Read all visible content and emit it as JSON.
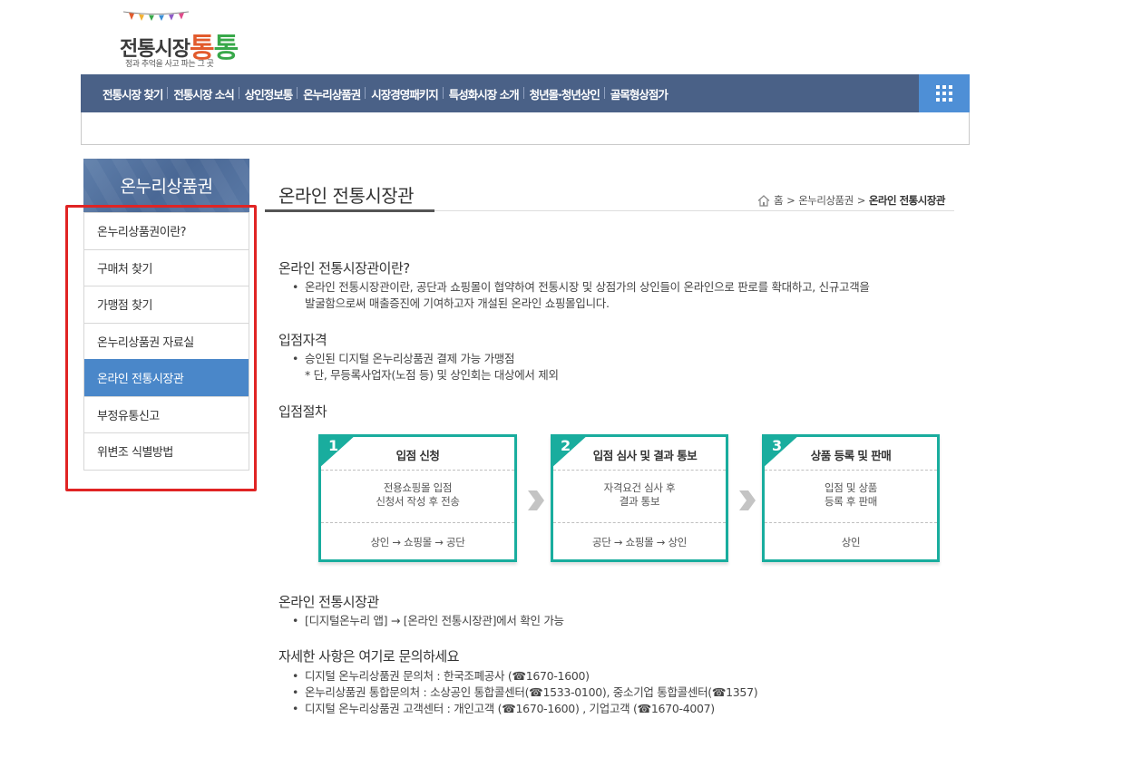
{
  "logo": {
    "brand_main": "전통시장",
    "brand_accent1": "통",
    "brand_accent2": "통",
    "tagline": "정과 추억을 사고 파는 그 곳"
  },
  "gnb": {
    "items": [
      "전통시장 찾기",
      "전통시장 소식",
      "상인정보통",
      "온누리상품권",
      "시장경영패키지",
      "특성화시장 소개",
      "청년몰·청년상인",
      "골목형상점가"
    ],
    "all_menu_icon": "grid-icon"
  },
  "lnb": {
    "title": "온누리상품권",
    "items": [
      "온누리상품권이란?",
      "구매처 찾기",
      "가맹점 찾기",
      "온누리상품권 자료실",
      "온라인 전통시장관",
      "부정유통신고",
      "위변조 식별방법"
    ],
    "active_index": 4
  },
  "content": {
    "title": "온라인 전통시장관",
    "breadcrumb": {
      "home": "홈",
      "sep": ">",
      "level1": "온누리상품권",
      "current": "온라인 전통시장관"
    },
    "sections": {
      "intro": {
        "heading": "온라인 전통시장관이란?",
        "line1": "온라인 전통시장관이란, 공단과 쇼핑몰이 협약하여 전통시장 및 상점가의 상인들이 온라인으로 판로를 확대하고, 신규고객을",
        "line2": "발굴함으로써 매출증진에 기여하고자 개설된 온라인 쇼핑몰입니다."
      },
      "qualification": {
        "heading": "입점자격",
        "item": "승인된 디지털 온누리상품권 결제 가능 가맹점",
        "note": "* 단, 무등록사업자(노점 등) 및 상인회는 대상에서 제외"
      },
      "procedure": {
        "heading": "입점절차",
        "steps": [
          {
            "num": "1",
            "title": "입점 신청",
            "desc1": "전용쇼핑몰 입점",
            "desc2": "신청서 작성 후 전송",
            "flow": "상인 → 쇼핑몰 → 공단"
          },
          {
            "num": "2",
            "title": "입점 심사 및 결과 통보",
            "desc1": "자격요건 심사 후",
            "desc2": "결과 통보",
            "flow": "공단 → 쇼핑몰 → 상인"
          },
          {
            "num": "3",
            "title": "상품 등록 및 판매",
            "desc1": "입점 및 상품",
            "desc2": "등록 후 판매",
            "flow": "상인"
          }
        ]
      },
      "online": {
        "heading": "온라인 전통시장관",
        "item": "[디지털온누리 앱] → [온라인 전통시장관]에서 확인 가능"
      },
      "contact": {
        "heading": "자세한 사항은 여기로 문의하세요",
        "items": [
          "디지털 온누리상품권 문의처 : 한국조폐공사 (☎1670-1600)",
          "온누리상품권 통합문의처 : 소상공인 통합콜센터(☎1533-0100), 중소기업 통합콜센터(☎1357)",
          "디지털 온누리상품권 고객센터 : 개인고객 (☎1670-1600) , 기업고객 (☎1670-4007)"
        ]
      }
    }
  },
  "colors": {
    "gnb_bg": "#4a6187",
    "gnb_all_bg": "#4e8fd6",
    "lnb_active": "#4a87c9",
    "step_accent": "#19ad9e",
    "highlight": "#e02424"
  }
}
